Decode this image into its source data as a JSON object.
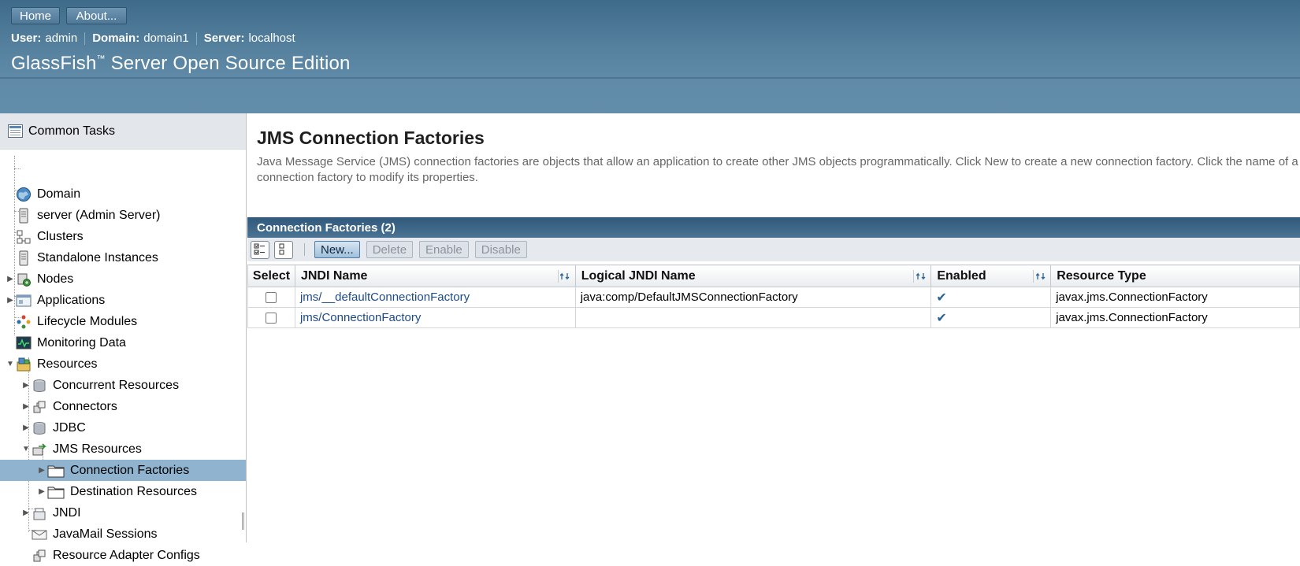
{
  "header": {
    "home_label": "Home",
    "about_label": "About...",
    "user_label": "User:",
    "user_value": "admin",
    "domain_label": "Domain:",
    "domain_value": "domain1",
    "server_label": "Server:",
    "server_value": "localhost",
    "product_name": "GlassFish",
    "product_tm": "™",
    "product_suffix": " Server Open Source Edition"
  },
  "sidebar": {
    "header": "Common Tasks",
    "items": [
      {
        "label": "Domain",
        "icon": "globe-icon"
      },
      {
        "label": "server (Admin Server)",
        "icon": "server-icon"
      },
      {
        "label": "Clusters",
        "icon": "cluster-icon"
      },
      {
        "label": "Standalone Instances",
        "icon": "server-icon"
      },
      {
        "label": "Nodes",
        "icon": "nodes-icon"
      },
      {
        "label": "Applications",
        "icon": "applications-icon"
      },
      {
        "label": "Lifecycle Modules",
        "icon": "lifecycle-icon"
      },
      {
        "label": "Monitoring Data",
        "icon": "monitor-icon"
      },
      {
        "label": "Resources",
        "icon": "resources-icon"
      },
      {
        "label": "Concurrent Resources",
        "icon": "database-icon"
      },
      {
        "label": "Connectors",
        "icon": "connector-icon"
      },
      {
        "label": "JDBC",
        "icon": "database-icon"
      },
      {
        "label": "JMS Resources",
        "icon": "jms-icon"
      },
      {
        "label": "Connection Factories",
        "icon": "folder-icon"
      },
      {
        "label": "Destination Resources",
        "icon": "folder-icon"
      },
      {
        "label": "JNDI",
        "icon": "jndi-icon"
      },
      {
        "label": "JavaMail Sessions",
        "icon": "mail-icon"
      },
      {
        "label": "Resource Adapter Configs",
        "icon": "connector-icon"
      }
    ]
  },
  "main": {
    "title": "JMS Connection Factories",
    "help": "Java Message Service (JMS) connection factories are objects that allow an application to create other JMS objects programmatically. Click New to create a new connection factory. Click the name of a connection factory to modify its properties.",
    "table_title": "Connection Factories (2)",
    "actions": {
      "new": "New...",
      "delete": "Delete",
      "enable": "Enable",
      "disable": "Disable"
    },
    "columns": [
      "Select",
      "JNDI Name",
      "Logical JNDI Name",
      "Enabled",
      "Resource Type"
    ],
    "rows": [
      {
        "jndi": "jms/__defaultConnectionFactory",
        "logical": "java:comp/DefaultJMSConnectionFactory",
        "enabled": "✔",
        "type": "javax.jms.ConnectionFactory"
      },
      {
        "jndi": "jms/ConnectionFactory",
        "logical": "",
        "enabled": "✔",
        "type": "javax.jms.ConnectionFactory"
      }
    ]
  },
  "colors": {
    "masthead": "#55819f",
    "selected": "#90b4cf",
    "table_title": "#3a6385",
    "link": "#1d4a8a"
  }
}
